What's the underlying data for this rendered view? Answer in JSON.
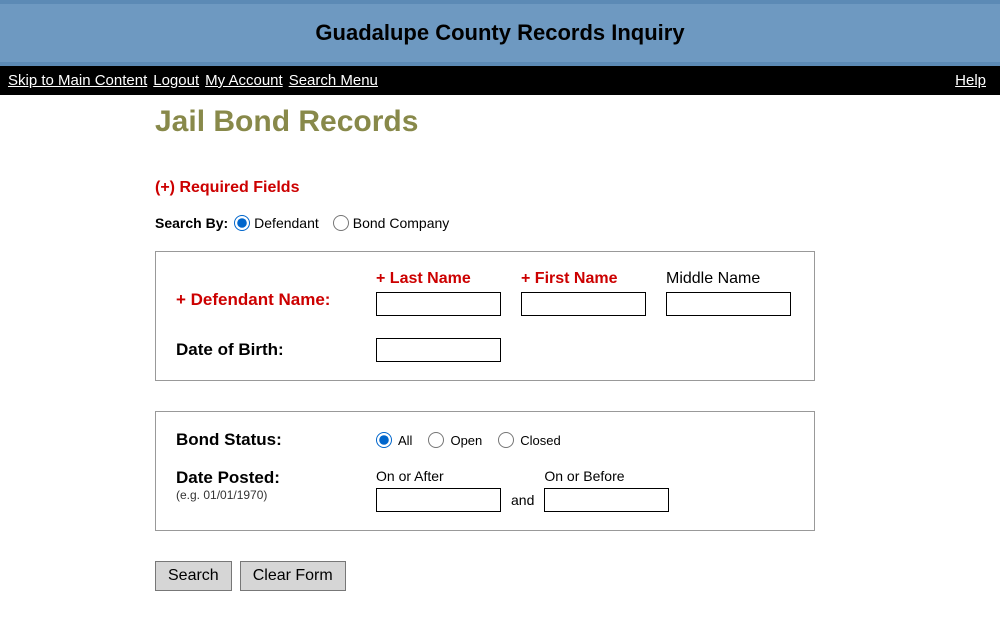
{
  "header": {
    "title": "Guadalupe County Records Inquiry"
  },
  "nav": {
    "skip": "Skip to Main Content",
    "logout": "Logout",
    "account": "My Account",
    "search_menu": "Search Menu",
    "help": "Help"
  },
  "page": {
    "heading": "Jail Bond Records",
    "required_note": "(+) Required Fields"
  },
  "search_by": {
    "label": "Search By:",
    "option_defendant": "Defendant",
    "option_bond_company": "Bond Company",
    "selected": "Defendant"
  },
  "defendant_box": {
    "name_label": "+ Defendant Name:",
    "last_name_label": "+ Last Name",
    "first_name_label": "+ First Name",
    "middle_name_label": "Middle Name",
    "last_name_value": "",
    "first_name_value": "",
    "middle_name_value": "",
    "dob_label": "Date of Birth:",
    "dob_value": ""
  },
  "bond_box": {
    "status_label": "Bond Status:",
    "option_all": "All",
    "option_open": "Open",
    "option_closed": "Closed",
    "selected": "All",
    "date_posted_label": "Date Posted:",
    "date_hint": "(e.g. 01/01/1970)",
    "on_after_label": "On or After",
    "on_before_label": "On or Before",
    "and_word": "and",
    "on_after_value": "",
    "on_before_value": ""
  },
  "buttons": {
    "search": "Search",
    "clear": "Clear Form"
  }
}
